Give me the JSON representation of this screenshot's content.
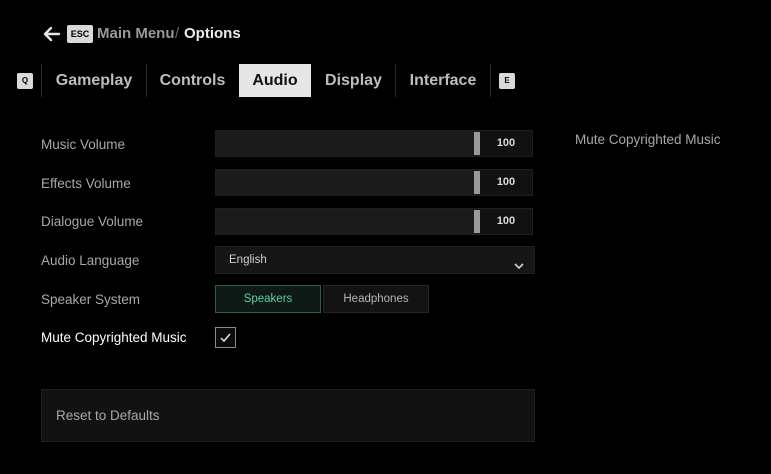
{
  "header": {
    "back_key": "ESC",
    "parent": "Main Menu",
    "separator": "/",
    "current": "Options"
  },
  "tabs": {
    "prev_key": "Q",
    "next_key": "E",
    "items": [
      {
        "label": "Gameplay",
        "active": false
      },
      {
        "label": "Controls",
        "active": false
      },
      {
        "label": "Audio",
        "active": true
      },
      {
        "label": "Display",
        "active": false
      },
      {
        "label": "Interface",
        "active": false
      }
    ]
  },
  "settings": {
    "music_volume": {
      "label": "Music Volume",
      "value": 100,
      "max": 100,
      "display": "100"
    },
    "effects_volume": {
      "label": "Effects Volume",
      "value": 100,
      "max": 100,
      "display": "100"
    },
    "dialogue_volume": {
      "label": "Dialogue Volume",
      "value": 100,
      "max": 100,
      "display": "100"
    },
    "audio_language": {
      "label": "Audio Language",
      "value": "English"
    },
    "speaker_system": {
      "label": "Speaker System",
      "options": [
        "Speakers",
        "Headphones"
      ],
      "selected": "Speakers"
    },
    "mute_copyrighted": {
      "label": "Mute Copyrighted Music",
      "checked": true
    }
  },
  "reset_label": "Reset to Defaults",
  "description": {
    "title": "Mute Copyrighted Music"
  },
  "colors": {
    "accent": "#5fd0a8",
    "tab_active_bg": "#e6e6e6",
    "background": "#000000"
  }
}
